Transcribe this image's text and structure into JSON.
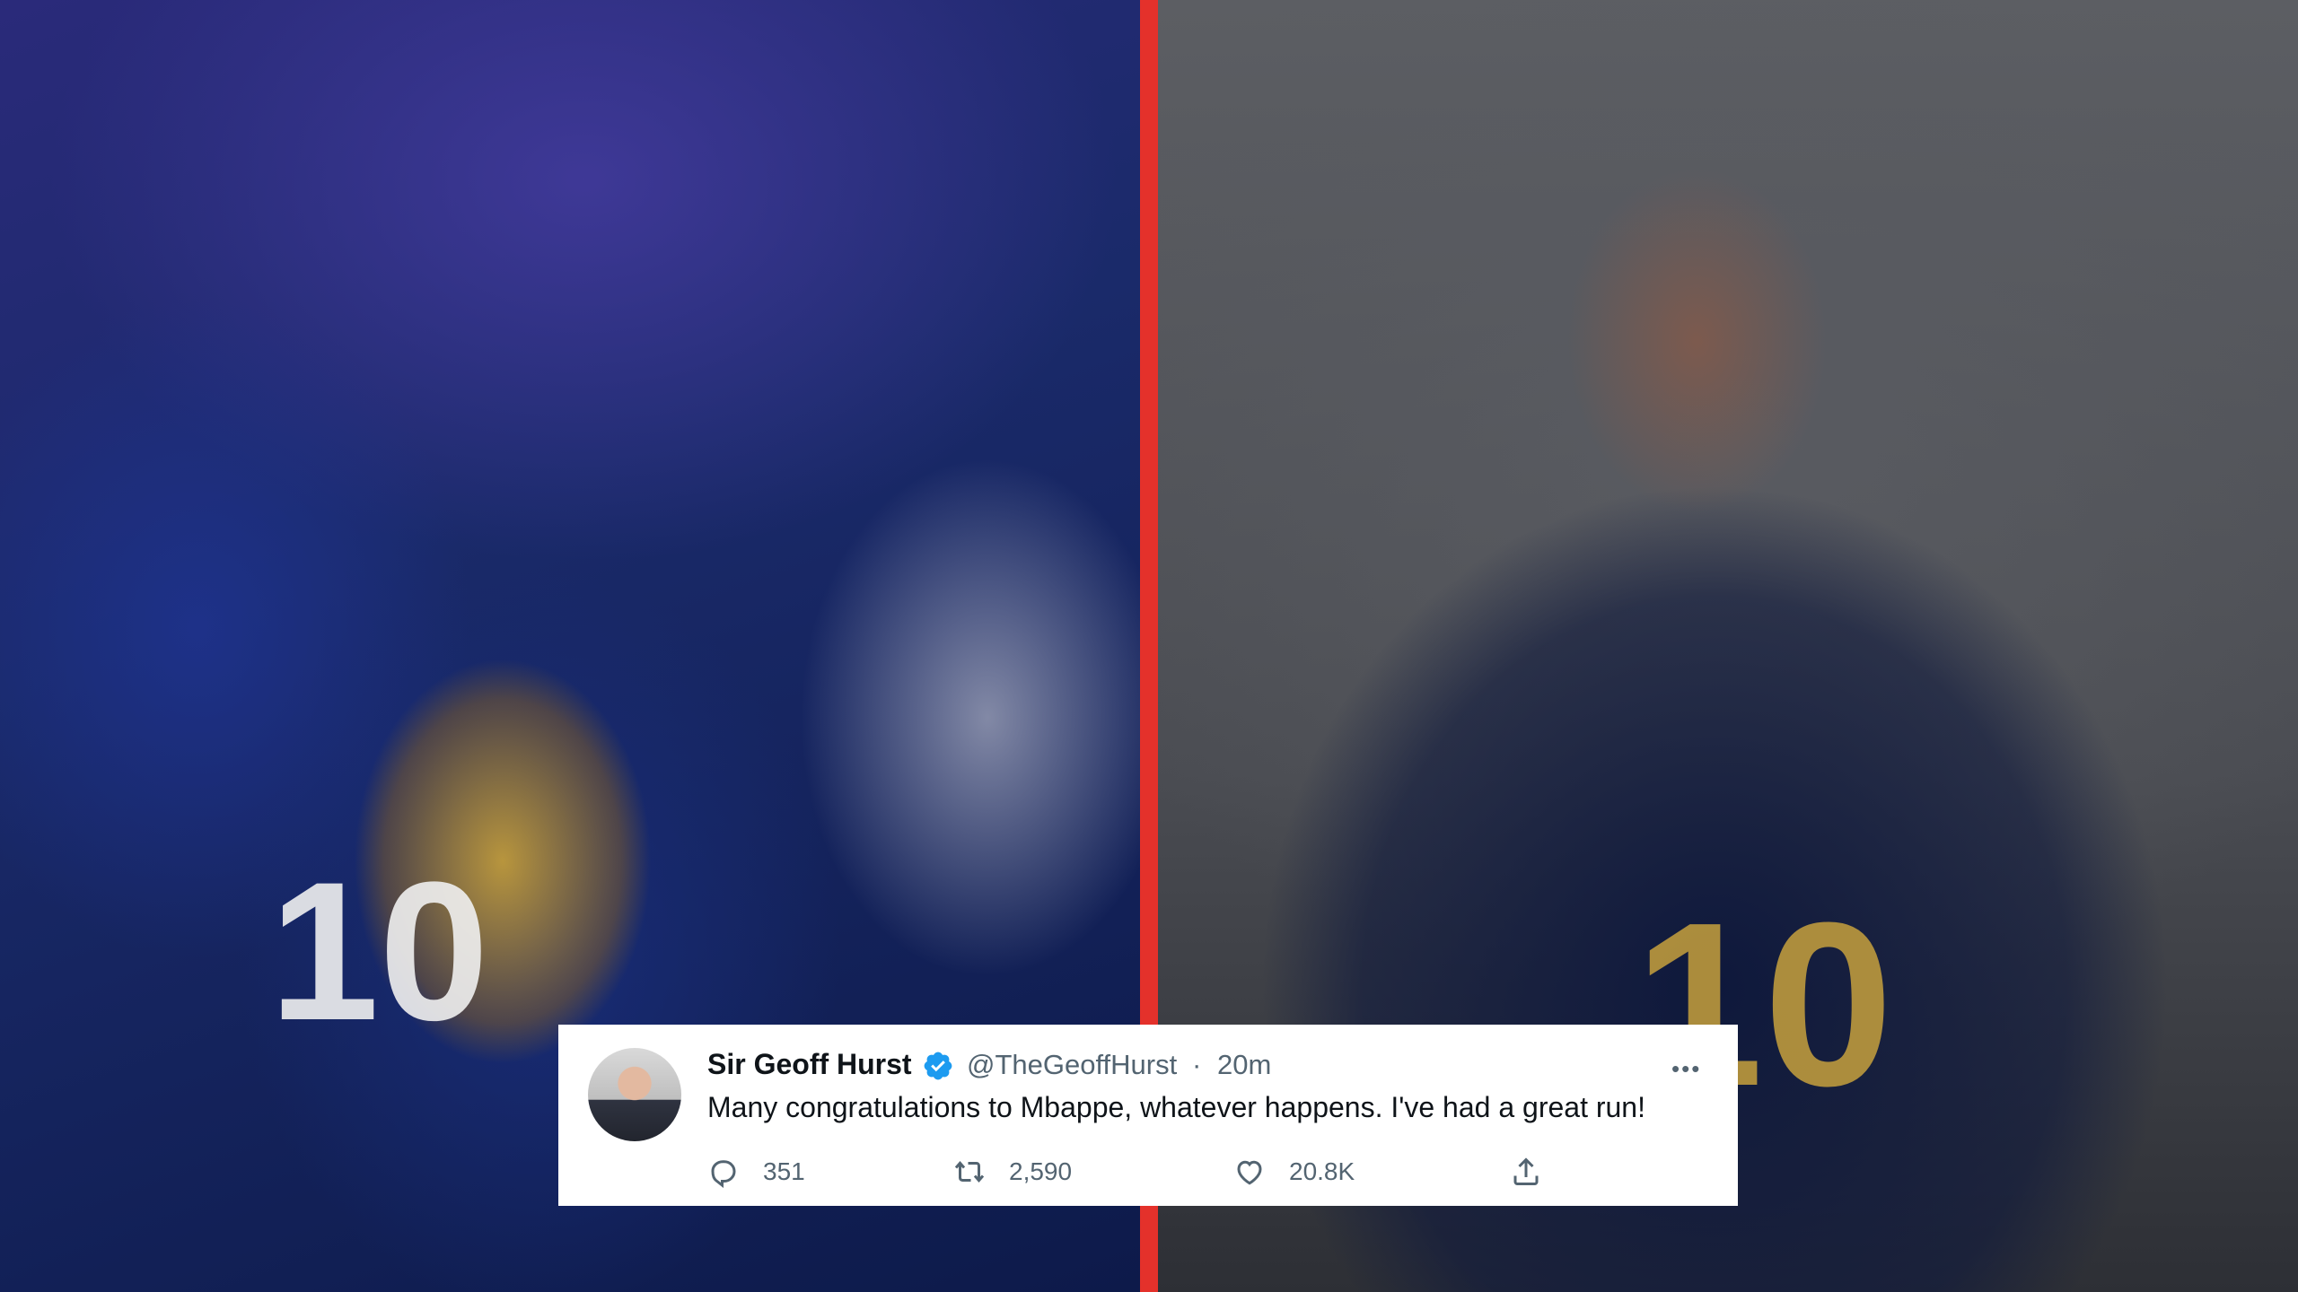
{
  "tweet": {
    "author_name": "Sir Geoff Hurst",
    "handle": "@TheGeoffHurst",
    "separator": "·",
    "time": "20m",
    "text": "Many congratulations to Mbappe, whatever happens. I've had a great run!",
    "more_icon": "more-horizontal-icon",
    "actions": {
      "replies": "351",
      "retweets": "2,590",
      "likes": "20.8K"
    }
  },
  "colors": {
    "divider": "#e4312b",
    "verified": "#1d9bf0",
    "card_background": "#ffffff"
  }
}
